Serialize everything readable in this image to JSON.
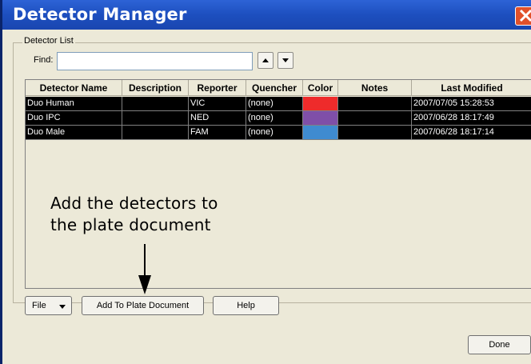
{
  "window": {
    "title": "Detector Manager"
  },
  "group": {
    "label": "Detector List"
  },
  "find": {
    "label": "Find:",
    "value": ""
  },
  "table": {
    "columns": [
      "Detector Name",
      "Description",
      "Reporter",
      "Quencher",
      "Color",
      "Notes",
      "Last Modified"
    ],
    "rows": [
      {
        "name": "Duo Human",
        "description": "",
        "reporter": "VIC",
        "quencher": "(none)",
        "color": "#ee2b2b",
        "notes": "",
        "modified": "2007/07/05 15:28:53"
      },
      {
        "name": "Duo IPC",
        "description": "",
        "reporter": "NED",
        "quencher": "(none)",
        "color": "#7f4fa8",
        "notes": "",
        "modified": "2007/06/28 18:17:49"
      },
      {
        "name": "Duo Male",
        "description": "",
        "reporter": "FAM",
        "quencher": "(none)",
        "color": "#3f8bd0",
        "notes": "",
        "modified": "2007/06/28 18:17:14"
      }
    ]
  },
  "buttons": {
    "file": "File",
    "add_to_plate": "Add To Plate Document",
    "help": "Help",
    "done": "Done"
  },
  "annotation": {
    "line1": "Add the detectors to",
    "line2": "the plate document"
  },
  "icons": {
    "close": "close-x-icon",
    "up": "arrow-up-icon",
    "down": "arrow-down-icon",
    "dropdown": "triangle-down-icon"
  }
}
